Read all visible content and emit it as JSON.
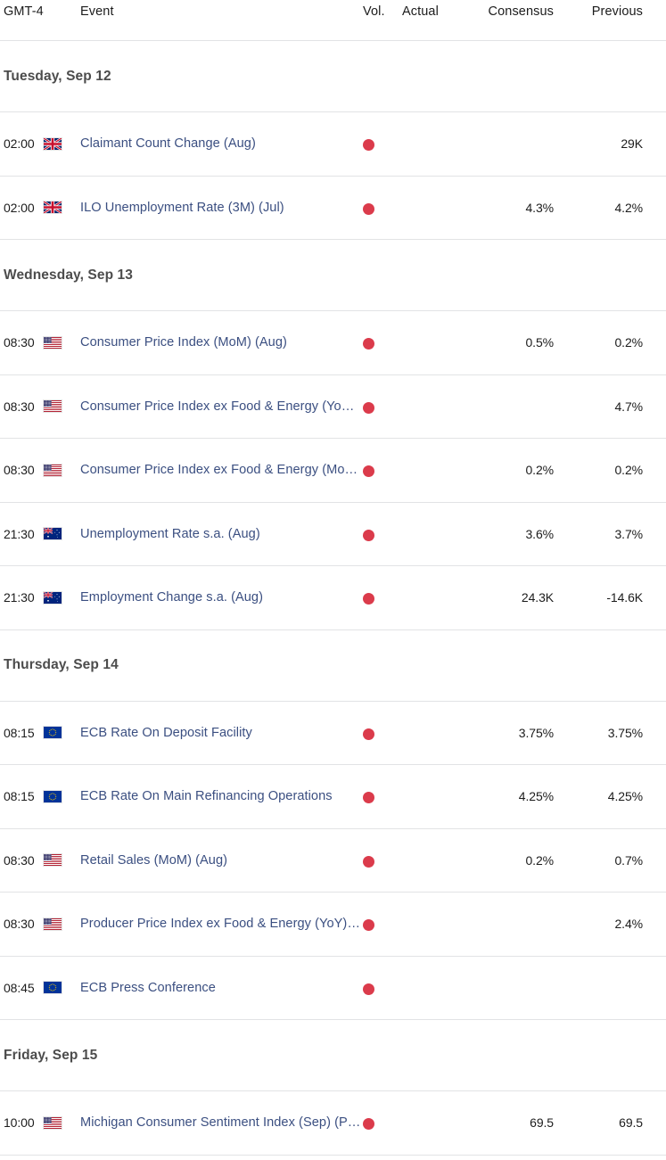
{
  "header": {
    "timezone": "GMT-4",
    "event": "Event",
    "vol": "Vol.",
    "actual": "Actual",
    "consensus": "Consensus",
    "previous": "Previous"
  },
  "accent": {
    "event_link": "#3b4f81",
    "vol_high": "#db3b4b",
    "day_heading": "#4c4c4c",
    "row_border": "#e2e3e5"
  },
  "groups": [
    {
      "date": "Tuesday, Sep 12",
      "rows": [
        {
          "time": "02:00",
          "flag": "flag-uk",
          "country": "United Kingdom",
          "event": "Claimant Count Change (Aug)",
          "vol": "vol-high-icon",
          "actual": "",
          "consensus": "",
          "previous": "29K"
        },
        {
          "time": "02:00",
          "flag": "flag-uk",
          "country": "United Kingdom",
          "event": "ILO Unemployment Rate (3M) (Jul)",
          "vol": "vol-high-icon",
          "actual": "",
          "consensus": "4.3%",
          "previous": "4.2%"
        }
      ]
    },
    {
      "date": "Wednesday, Sep 13",
      "rows": [
        {
          "time": "08:30",
          "flag": "flag-us",
          "country": "United States",
          "event": "Consumer Price Index (MoM) (Aug)",
          "vol": "vol-high-icon",
          "actual": "",
          "consensus": "0.5%",
          "previous": "0.2%"
        },
        {
          "time": "08:30",
          "flag": "flag-us",
          "country": "United States",
          "event": "Consumer Price Index ex Food & Energy (YoY) (Aug)",
          "vol": "vol-high-icon",
          "actual": "",
          "consensus": "",
          "previous": "4.7%"
        },
        {
          "time": "08:30",
          "flag": "flag-us",
          "country": "United States",
          "event": "Consumer Price Index ex Food & Energy (MoM) (Aug)",
          "vol": "vol-high-icon",
          "actual": "",
          "consensus": "0.2%",
          "previous": "0.2%"
        },
        {
          "time": "21:30",
          "flag": "flag-au",
          "country": "Australia",
          "event": "Unemployment Rate s.a. (Aug)",
          "vol": "vol-high-icon",
          "actual": "",
          "consensus": "3.6%",
          "previous": "3.7%"
        },
        {
          "time": "21:30",
          "flag": "flag-au",
          "country": "Australia",
          "event": "Employment Change s.a. (Aug)",
          "vol": "vol-high-icon",
          "actual": "",
          "consensus": "24.3K",
          "previous": "-14.6K"
        }
      ]
    },
    {
      "date": "Thursday, Sep 14",
      "rows": [
        {
          "time": "08:15",
          "flag": "flag-eu",
          "country": "European Union",
          "event": "ECB Rate On Deposit Facility",
          "vol": "vol-high-icon",
          "actual": "",
          "consensus": "3.75%",
          "previous": "3.75%"
        },
        {
          "time": "08:15",
          "flag": "flag-eu",
          "country": "European Union",
          "event": "ECB Rate On Main Refinancing Operations",
          "vol": "vol-high-icon",
          "actual": "",
          "consensus": "4.25%",
          "previous": "4.25%"
        },
        {
          "time": "08:30",
          "flag": "flag-us",
          "country": "United States",
          "event": "Retail Sales (MoM) (Aug)",
          "vol": "vol-high-icon",
          "actual": "",
          "consensus": "0.2%",
          "previous": "0.7%"
        },
        {
          "time": "08:30",
          "flag": "flag-us",
          "country": "United States",
          "event": "Producer Price Index ex Food & Energy (YoY) (Aug)",
          "vol": "vol-high-icon",
          "actual": "",
          "consensus": "",
          "previous": "2.4%"
        },
        {
          "time": "08:45",
          "flag": "flag-eu",
          "country": "European Union",
          "event": "ECB Press Conference",
          "vol": "vol-high-icon",
          "actual": "",
          "consensus": "",
          "previous": ""
        }
      ]
    },
    {
      "date": "Friday, Sep 15",
      "rows": [
        {
          "time": "10:00",
          "flag": "flag-us",
          "country": "United States",
          "event": "Michigan Consumer Sentiment Index (Sep) (Prel)",
          "vol": "vol-high-icon",
          "actual": "",
          "consensus": "69.5",
          "previous": "69.5"
        }
      ]
    }
  ]
}
